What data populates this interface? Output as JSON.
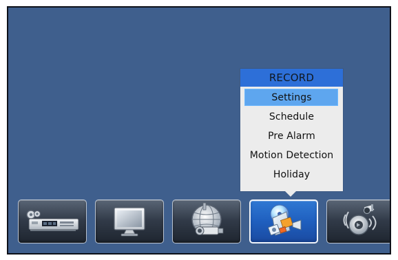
{
  "record_menu": {
    "title": "RECORD",
    "items": [
      {
        "label": "Settings",
        "selected": true
      },
      {
        "label": "Schedule",
        "selected": false
      },
      {
        "label": "Pre Alarm",
        "selected": false
      },
      {
        "label": "Motion Detection",
        "selected": false
      },
      {
        "label": "Holiday",
        "selected": false
      }
    ]
  },
  "toolbar": {
    "buttons": [
      {
        "icon": "dvr-icon",
        "active": false
      },
      {
        "icon": "monitor-icon",
        "active": false
      },
      {
        "icon": "network-camera-icon",
        "active": false
      },
      {
        "icon": "record-icon",
        "active": true
      },
      {
        "icon": "camera-audio-icon",
        "active": false
      }
    ]
  },
  "colors": {
    "screen_background": "#3f5f8d",
    "menu_background": "#ececec",
    "menu_header": "#2d6fd8",
    "menu_selected": "#5ea6ef",
    "toolbar_active": "#1f5fbf"
  }
}
